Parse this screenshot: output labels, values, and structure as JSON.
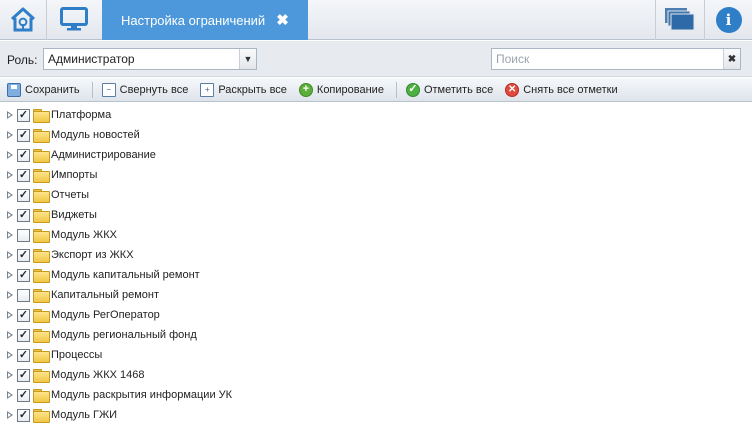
{
  "header": {
    "tab_title": "Настройка ограничений",
    "tab_close": "✖",
    "info_label": "i"
  },
  "role": {
    "label": "Роль:",
    "selected": "Администратор",
    "dropdown_arrow": "▼"
  },
  "search": {
    "placeholder": "Поиск",
    "value": "",
    "clear": "✖"
  },
  "toolbar": {
    "save": "Сохранить",
    "collapse_all": "Свернуть все",
    "expand_all": "Раскрыть все",
    "copy": "Копирование",
    "check_all": "Отметить все",
    "uncheck_all": "Снять все отметки"
  },
  "tree": {
    "items": [
      {
        "label": "Платформа",
        "checked": true
      },
      {
        "label": "Модуль новостей",
        "checked": true
      },
      {
        "label": "Администрирование",
        "checked": true
      },
      {
        "label": "Импорты",
        "checked": true
      },
      {
        "label": "Отчеты",
        "checked": true
      },
      {
        "label": "Виджеты",
        "checked": true
      },
      {
        "label": "Модуль ЖКХ",
        "checked": false
      },
      {
        "label": "Экспорт из ЖКХ",
        "checked": true
      },
      {
        "label": "Модуль капитальный ремонт",
        "checked": true
      },
      {
        "label": "Капитальный ремонт",
        "checked": false
      },
      {
        "label": "Модуль РегОператор",
        "checked": true
      },
      {
        "label": "Модуль региональный фонд",
        "checked": true
      },
      {
        "label": "Процессы",
        "checked": true
      },
      {
        "label": "Модуль ЖКХ 1468",
        "checked": true
      },
      {
        "label": "Модуль раскрытия информации УК",
        "checked": true
      },
      {
        "label": "Модуль ГЖИ",
        "checked": true
      }
    ]
  },
  "colors": {
    "accent": "#4d98da",
    "topbar_bg": "#e3e7ed",
    "toolbar_bg": "#dfe4eb",
    "folder": "#f0c545"
  },
  "icons": {
    "home": "home-icon",
    "desktop": "monitor-icon",
    "windows": "windows-stack-icon",
    "info": "info-icon"
  }
}
